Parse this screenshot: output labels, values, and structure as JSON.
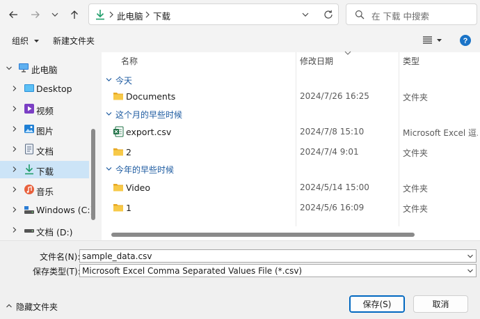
{
  "nav": {
    "breadcrumb": [
      "此电脑",
      "下载"
    ],
    "search_placeholder": "在 下载 中搜索"
  },
  "toolbar": {
    "organize_label": "组织",
    "new_folder_label": "新建文件夹"
  },
  "sidebar": {
    "items": [
      {
        "label": "此电脑",
        "icon": "computer-icon",
        "expanded": true
      },
      {
        "label": "Desktop",
        "icon": "desktop-icon"
      },
      {
        "label": "视频",
        "icon": "video-icon"
      },
      {
        "label": "图片",
        "icon": "pictures-icon"
      },
      {
        "label": "文档",
        "icon": "documents-icon"
      },
      {
        "label": "下载",
        "icon": "download-icon",
        "selected": true
      },
      {
        "label": "音乐",
        "icon": "music-icon"
      },
      {
        "label": "Windows (C:)",
        "icon": "drive-icon"
      },
      {
        "label": "文档 (D:)",
        "icon": "drive-icon"
      }
    ]
  },
  "columns": {
    "name": "名称",
    "date": "修改日期",
    "type": "类型"
  },
  "groups": [
    {
      "label": "今天",
      "rows": [
        {
          "name": "Documents",
          "date": "2024/7/26 16:25",
          "type": "文件夹",
          "icon": "folder-icon"
        }
      ]
    },
    {
      "label": "这个月的早些时候",
      "rows": [
        {
          "name": "export.csv",
          "date": "2024/7/8 15:10",
          "type": "Microsoft Excel 逗...",
          "icon": "excel-icon"
        },
        {
          "name": "2",
          "date": "2024/7/4 9:01",
          "type": "文件夹",
          "icon": "folder-icon"
        }
      ]
    },
    {
      "label": "今年的早些时候",
      "rows": [
        {
          "name": "Video",
          "date": "2024/5/14 15:00",
          "type": "文件夹",
          "icon": "folder-icon"
        },
        {
          "name": "1",
          "date": "2024/5/6 16:09",
          "type": "文件夹",
          "icon": "folder-icon"
        }
      ]
    }
  ],
  "form": {
    "filename_label": "文件名(N):",
    "filename_value": "sample_data.csv",
    "filetype_label": "保存类型(T):",
    "filetype_value": "Microsoft Excel Comma Separated Values File (*.csv)",
    "hide_folders_label": "隐藏文件夹",
    "save_label": "保存(S)",
    "cancel_label": "取消"
  },
  "colors": {
    "accent": "#0067c0",
    "selected": "#cce4f7",
    "group": "#1c5aa0",
    "folder": "#f5c242",
    "excel": "#1d7044"
  }
}
